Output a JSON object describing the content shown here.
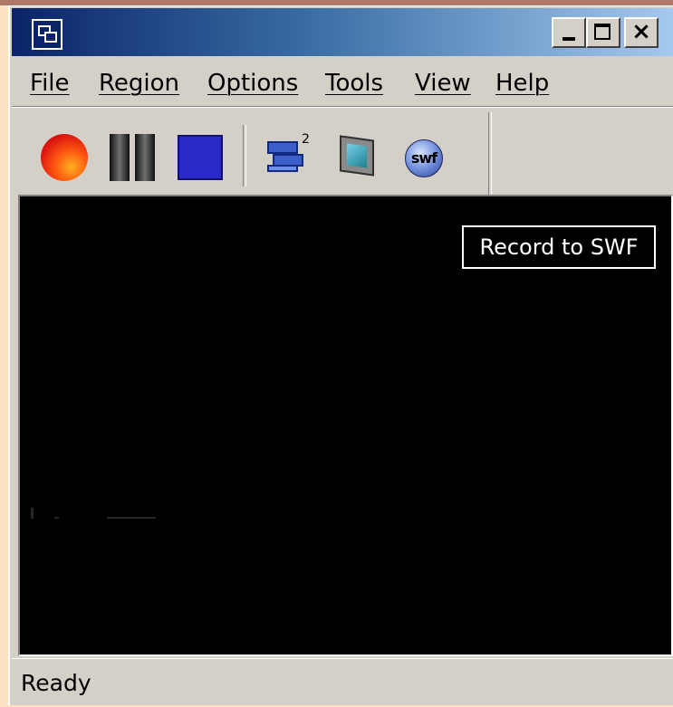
{
  "window": {
    "title": "",
    "controls": {
      "minimize": "minimize",
      "maximize": "maximize",
      "close": "×"
    }
  },
  "menu": {
    "items": [
      {
        "label": "File"
      },
      {
        "label": "Region"
      },
      {
        "label": "Options"
      },
      {
        "label": "Tools"
      },
      {
        "label": "View"
      },
      {
        "label": "Help"
      }
    ]
  },
  "toolbar": {
    "buttons": [
      {
        "icon": "record-icon",
        "color": "#e02010"
      },
      {
        "icon": "pause-icon",
        "color": "#303030"
      },
      {
        "icon": "stop-icon",
        "color": "#2a2ac8"
      },
      {
        "icon": "settings-windows-icon",
        "color": "#3b5ec8",
        "superscript": "2"
      },
      {
        "icon": "record-to-avi-icon",
        "color": "#1a8090"
      },
      {
        "icon": "record-to-swf-icon",
        "label": "swf",
        "color": "#6a8ad8"
      }
    ]
  },
  "viewport": {
    "background": "#000000",
    "tooltip": "Record to SWF"
  },
  "status": {
    "text": "Ready"
  }
}
